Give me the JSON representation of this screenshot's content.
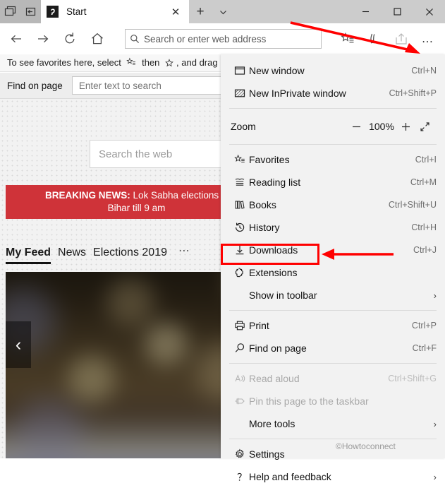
{
  "window": {
    "titlebar": {
      "tab_overview_icon": "tab-overview-icon",
      "set_aside_icon": "set-tabs-aside-icon",
      "tab_title": "Start",
      "favicon_glyph": "ʔ",
      "close_tab_glyph": "✕",
      "new_tab_glyph": "+",
      "tab_dropdown_glyph": "⌄",
      "minimize_glyph": "─",
      "maximize_glyph": "□",
      "close_glyph": "✕"
    },
    "toolbar": {
      "back_glyph": "←",
      "forward_glyph": "→",
      "refresh_glyph": "↻",
      "home_glyph": "⌂",
      "address_placeholder": "Search or enter web address",
      "favorites_icon": "favorites-star-list-icon",
      "notes_icon": "web-note-pen-icon",
      "share_icon": "share-icon",
      "more_glyph": "…"
    }
  },
  "favorites_bar": {
    "text_before": "To see favorites here, select",
    "text_middle": "then",
    "text_after": ", and drag"
  },
  "find_bar": {
    "label": "Find on page",
    "placeholder": "Enter text to search"
  },
  "page": {
    "web_search_placeholder": "Search the web",
    "breaking_news": {
      "label": "BREAKING NEWS:",
      "line1": "Lok Sabha elections pha",
      "line2": "Bihar till 9 am"
    },
    "feed_tabs": [
      {
        "label": "My Feed",
        "active": true
      },
      {
        "label": "News",
        "active": false
      },
      {
        "label": "Elections 2019",
        "active": false
      }
    ],
    "feed_more_glyph": "⋯",
    "hero_prev_glyph": "‹"
  },
  "menu": {
    "groups": [
      {
        "items": [
          {
            "name": "new-window",
            "icon": "new-window-icon",
            "label": "New window",
            "accel": "Ctrl+N",
            "disabled": false,
            "submenu": false
          },
          {
            "name": "new-inprivate-window",
            "icon": "inprivate-window-icon",
            "label": "New InPrivate window",
            "accel": "Ctrl+Shift+P",
            "disabled": false,
            "submenu": false
          }
        ]
      }
    ],
    "zoom": {
      "label": "Zoom",
      "minus_glyph": "─",
      "value": "100%",
      "plus_glyph": "+",
      "fullscreen_icon": "fullscreen-icon"
    },
    "group2": [
      {
        "name": "favorites",
        "icon": "favorites-icon",
        "label": "Favorites",
        "accel": "Ctrl+I",
        "disabled": false,
        "submenu": false
      },
      {
        "name": "reading-list",
        "icon": "reading-list-icon",
        "label": "Reading list",
        "accel": "Ctrl+M",
        "disabled": false,
        "submenu": false
      },
      {
        "name": "books",
        "icon": "books-icon",
        "label": "Books",
        "accel": "Ctrl+Shift+U",
        "disabled": false,
        "submenu": false
      },
      {
        "name": "history",
        "icon": "history-icon",
        "label": "History",
        "accel": "Ctrl+H",
        "disabled": false,
        "submenu": false
      },
      {
        "name": "downloads",
        "icon": "downloads-icon",
        "label": "Downloads",
        "accel": "Ctrl+J",
        "disabled": false,
        "submenu": false
      },
      {
        "name": "extensions",
        "icon": "extensions-puzzle-icon",
        "label": "Extensions",
        "accel": "",
        "disabled": false,
        "submenu": false,
        "highlighted": true
      },
      {
        "name": "show-in-toolbar",
        "icon": "",
        "label": "Show in toolbar",
        "accel": "",
        "disabled": false,
        "submenu": true
      }
    ],
    "group3": [
      {
        "name": "print",
        "icon": "printer-icon",
        "label": "Print",
        "accel": "Ctrl+P",
        "disabled": false,
        "submenu": false
      },
      {
        "name": "find-on-page",
        "icon": "search-icon",
        "label": "Find on page",
        "accel": "Ctrl+F",
        "disabled": false,
        "submenu": false
      }
    ],
    "group4": [
      {
        "name": "read-aloud",
        "icon": "read-aloud-icon",
        "label": "Read aloud",
        "accel": "Ctrl+Shift+G",
        "disabled": true,
        "submenu": false
      },
      {
        "name": "pin-to-taskbar",
        "icon": "pin-icon",
        "label": "Pin this page to the taskbar",
        "accel": "",
        "disabled": true,
        "submenu": false
      },
      {
        "name": "more-tools",
        "icon": "",
        "label": "More tools",
        "accel": "",
        "disabled": false,
        "submenu": true
      }
    ],
    "group5": [
      {
        "name": "settings",
        "icon": "gear-icon",
        "label": "Settings",
        "accel": "",
        "disabled": false,
        "submenu": false
      },
      {
        "name": "help-and-feedback",
        "icon": "question-mark-icon",
        "label": "Help and feedback",
        "accel": "",
        "disabled": false,
        "submenu": true
      }
    ],
    "submenu_chevron": "›"
  },
  "annotations": {
    "color": "#ff0000",
    "highlight_target": "Extensions",
    "arrow_top_target": "more-button"
  },
  "watermark": "©Howtoconnect"
}
